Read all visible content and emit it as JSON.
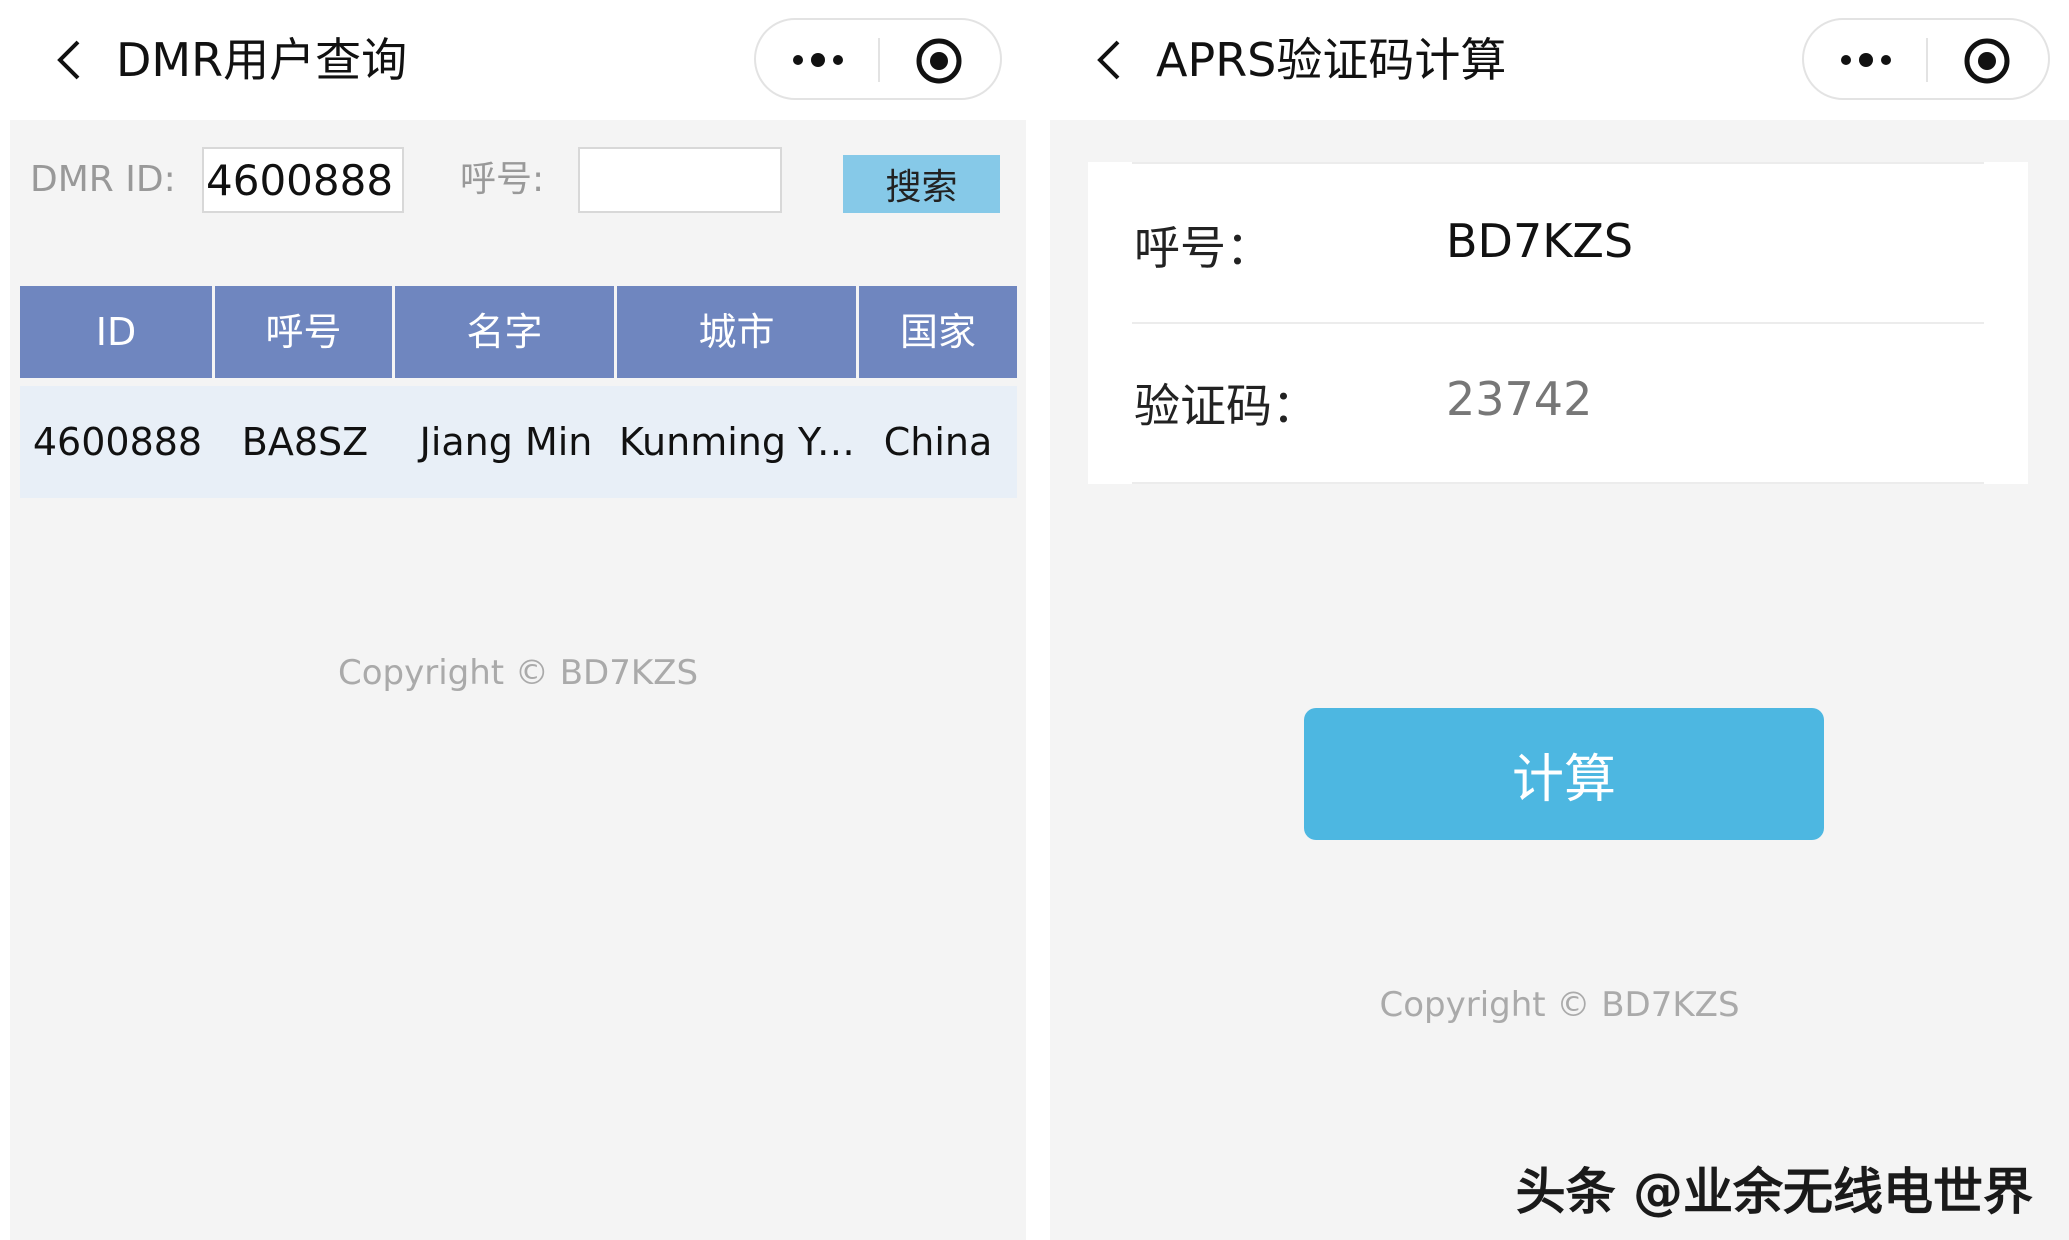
{
  "left": {
    "title": "DMR用户查询",
    "search": {
      "id_label": "DMR ID:",
      "id_value": "4600888",
      "callsign_label": "呼号:",
      "callsign_value": "",
      "button_label": "搜索"
    },
    "table": {
      "headers": [
        "ID",
        "呼号",
        "名字",
        "城市",
        "国家"
      ],
      "rows": [
        [
          "4600888",
          "BA8SZ",
          "Jiang Min",
          "Kunming Yu...",
          "China"
        ]
      ]
    },
    "copyright": "Copyright © BD7KZS"
  },
  "right": {
    "title": "APRS验证码计算",
    "form": {
      "callsign_label": "呼号：",
      "callsign_value": "BD7KZS",
      "code_label": "验证码：",
      "code_value": "23742"
    },
    "button_label": "计算",
    "copyright": "Copyright © BD7KZS"
  },
  "watermark": "头条 @业余无线电世界",
  "icons": [
    "back-arrow-icon",
    "more-dots-icon",
    "record-target-icon"
  ],
  "colors": {
    "table_header": "#6f86bf",
    "table_row": "#e8eff7",
    "search_button": "#86c9e8",
    "calc_button": "#4db7e1",
    "code_value": "#777777"
  }
}
